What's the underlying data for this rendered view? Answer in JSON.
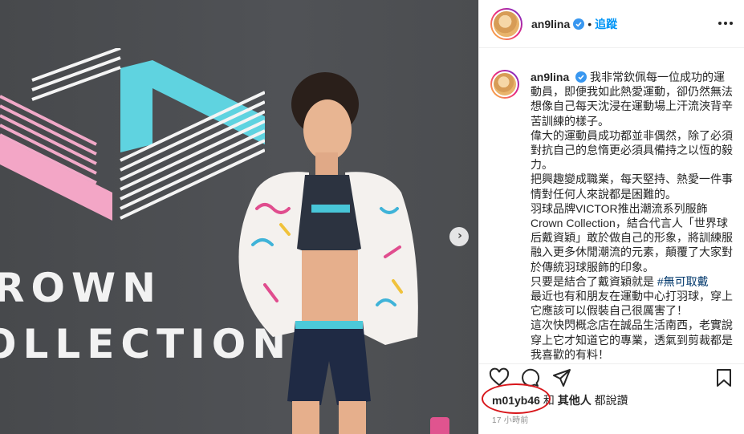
{
  "post": {
    "username": "an9lina",
    "follow_label": "追蹤",
    "dot": "•",
    "photo_text": {
      "line1": "ROWN",
      "line2": "OLLECTION"
    },
    "caption": [
      {
        "kind": "first",
        "text": "我非常欽佩每一位成功的運動員，即便我如此熱愛運動，卻仍然無法想像自己每天沈浸在運動場上汗流浹背辛苦訓練的樣子。"
      },
      {
        "kind": "plain",
        "text": "偉大的運動員成功都並非偶然，除了必須對抗自己的怠惰更必須具備持之以恆的毅力。"
      },
      {
        "kind": "plain",
        "text": "把興趣變成職業，每天堅持、熱愛一件事情對任何人來說都是困難的。"
      },
      {
        "kind": "plain",
        "text": "羽球品牌VICTOR推出潮流系列服飾Crown Collection，結合代言人「世界球后戴資穎」敢於做自己的形象，將訓練服融入更多休閒潮流的元素，顛覆了大家對於傳統羽球服飾的印象。"
      },
      {
        "kind": "tagline",
        "text": "只要是結合了戴資穎就是",
        "tag": "#無可取戴"
      },
      {
        "kind": "plain",
        "text": "最近也有和朋友在運動中心打羽球，穿上它應該可以假裝自己很厲害了！"
      },
      {
        "kind": "plain",
        "text": "這次快閃概念店在誠品生活南西，老實說穿上它才知道它的專業，透氣到剪裁都是我喜歡的有料！"
      }
    ],
    "likes": {
      "who": "m01yb46",
      "and": "和",
      "others": "其他人",
      "suffix": "都說讚"
    },
    "time": "17 小時前"
  }
}
